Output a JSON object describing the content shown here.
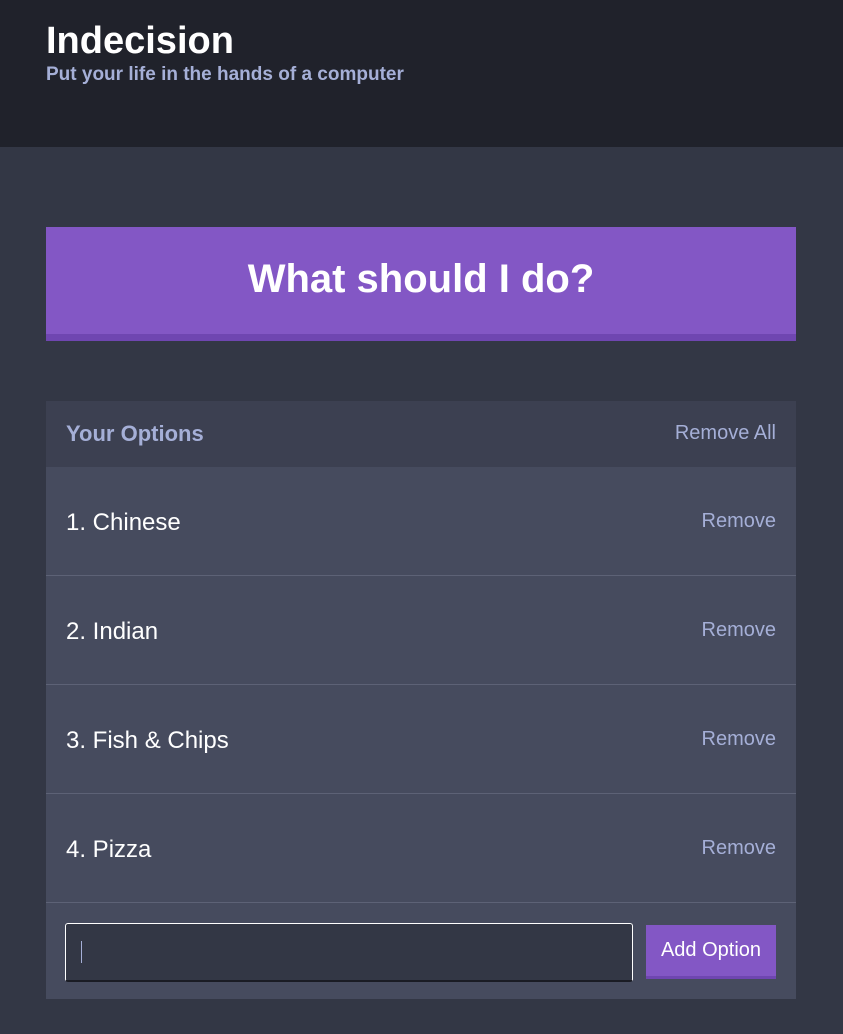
{
  "header": {
    "title": "Indecision",
    "subtitle": "Put your life in the hands of a computer"
  },
  "action": {
    "label": "What should I do?"
  },
  "options_widget": {
    "title": "Your Options",
    "remove_all_label": "Remove All",
    "items": [
      {
        "text": "1. Chinese",
        "remove_label": "Remove"
      },
      {
        "text": "2. Indian",
        "remove_label": "Remove"
      },
      {
        "text": "3. Fish & Chips",
        "remove_label": "Remove"
      },
      {
        "text": "4. Pizza",
        "remove_label": "Remove"
      }
    ]
  },
  "add_form": {
    "input_value": "",
    "button_label": "Add Option"
  },
  "colors": {
    "header_bg": "#20222b",
    "page_bg": "#333745",
    "accent_purple": "#8357c5",
    "widget_bg": "#464b5e",
    "widget_header_bg": "#3c4051",
    "muted_text": "#a5afd7"
  }
}
